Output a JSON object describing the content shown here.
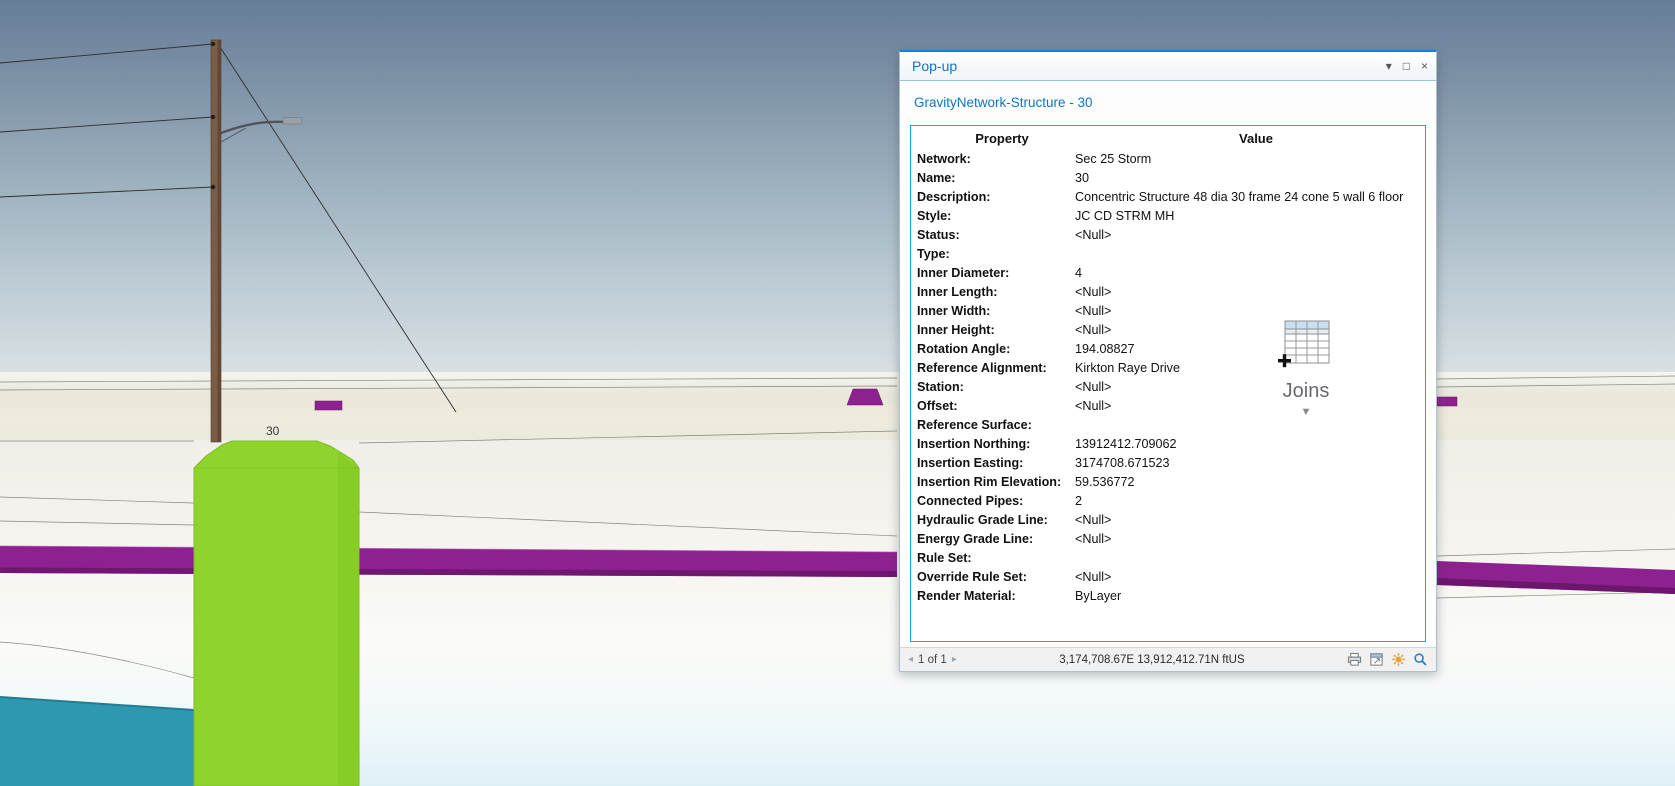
{
  "scene": {
    "structure_label": "30",
    "colors": {
      "sky_top": "#667d98",
      "sky_bottom": "#d8e0e3",
      "terrain": "#e9e6da",
      "structure_green": "#8ed42c",
      "pipe_purple": "#8e2190",
      "water_teal": "#2e98b0",
      "pole_brown": "#7b5c46"
    }
  },
  "popup": {
    "title": "Pop-up",
    "window_controls": {
      "menu_glyph": "▾",
      "maximize_glyph": "□",
      "close_glyph": "×"
    },
    "link": "GravityNetwork-Structure - 30",
    "table": {
      "headers": {
        "property": "Property",
        "value": "Value"
      },
      "rows": [
        {
          "property": "Network:",
          "value": "Sec 25 Storm"
        },
        {
          "property": "Name:",
          "value": "30"
        },
        {
          "property": "Description:",
          "value": "Concentric Structure 48 dia 30 frame 24 cone 5 wall 6 floor"
        },
        {
          "property": "Style:",
          "value": "JC CD STRM MH"
        },
        {
          "property": "Status:",
          "value": "<Null>"
        },
        {
          "property": "Type:",
          "value": ""
        },
        {
          "property": "Inner Diameter:",
          "value": "4"
        },
        {
          "property": "Inner Length:",
          "value": "<Null>"
        },
        {
          "property": "Inner Width:",
          "value": "<Null>"
        },
        {
          "property": "Inner Height:",
          "value": "<Null>"
        },
        {
          "property": "Rotation Angle:",
          "value": "194.08827"
        },
        {
          "property": "Reference Alignment:",
          "value": "Kirkton Raye Drive"
        },
        {
          "property": "Station:",
          "value": "<Null>"
        },
        {
          "property": "Offset:",
          "value": "<Null>"
        },
        {
          "property": "Reference Surface:",
          "value": ""
        },
        {
          "property": "Insertion Northing:",
          "value": "13912412.709062"
        },
        {
          "property": "Insertion Easting:",
          "value": "3174708.671523"
        },
        {
          "property": "Insertion Rim Elevation:",
          "value": "59.536772"
        },
        {
          "property": "Connected Pipes:",
          "value": "2"
        },
        {
          "property": "Hydraulic Grade Line:",
          "value": "<Null>"
        },
        {
          "property": "Energy Grade Line:",
          "value": "<Null>"
        },
        {
          "property": "Rule Set:",
          "value": ""
        },
        {
          "property": "Override Rule Set:",
          "value": "<Null>"
        },
        {
          "property": "Render Material:",
          "value": "ByLayer"
        }
      ]
    },
    "statusbar": {
      "pager_prev": "◂",
      "pager_next": "▸",
      "pager": "1 of 1",
      "coordinates": "3,174,708.67E 13,912,412.71N ftUS"
    }
  },
  "joins_cursor": {
    "label": "Joins",
    "chevron_glyph": "▼"
  }
}
